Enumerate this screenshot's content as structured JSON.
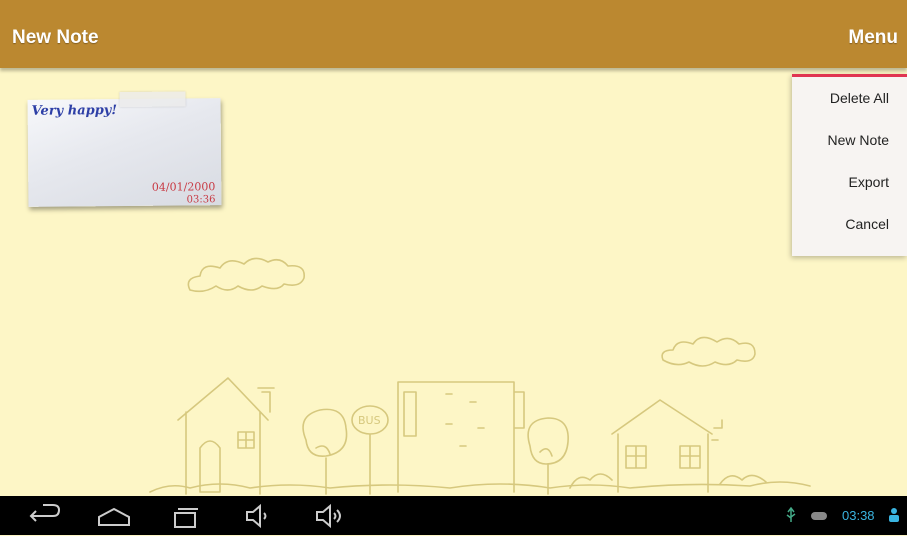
{
  "app": {
    "title": "New Note",
    "menu_label": "Menu"
  },
  "note": {
    "text": "Very happy!",
    "date": "04/01/2000",
    "time": "03:36"
  },
  "menu": {
    "items": [
      "Delete All",
      "New Note",
      "Export",
      "Cancel"
    ]
  },
  "system_bar": {
    "clock": "03:38"
  },
  "colors": {
    "toolbar": "#bb8830",
    "background": "#fdf6c6",
    "menu_accent": "#e03552",
    "clock": "#3ab4e0"
  }
}
